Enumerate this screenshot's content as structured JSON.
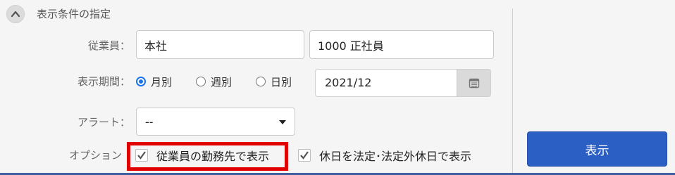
{
  "section": {
    "title": "表示条件の指定",
    "toggle_icon": "chevron-up-icon"
  },
  "employee": {
    "label": "従業員：",
    "office": "本社",
    "group": "1000 正社員"
  },
  "period": {
    "label": "表示期間：",
    "options": [
      "月別",
      "週別",
      "日別"
    ],
    "selected": "月別",
    "date": "2021/12",
    "calendar_icon": "calendar-icon"
  },
  "alert": {
    "label": "アラート：",
    "value": "--"
  },
  "options": {
    "label": "オプション",
    "items": [
      {
        "label": "従業員の勤務先で表示",
        "checked": true
      },
      {
        "label": "休日を法定･法定外休日で表示",
        "checked": true
      }
    ]
  },
  "actions": {
    "show_label": "表示"
  },
  "colors": {
    "accent": "#2c5fc3",
    "highlight": "#e00000",
    "radio": "#1a73e8"
  }
}
